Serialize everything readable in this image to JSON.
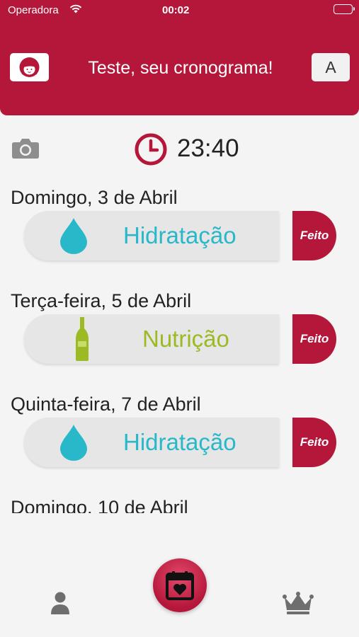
{
  "status_bar": {
    "carrier": "Operadora",
    "time": "00:02"
  },
  "header": {
    "title": "Teste, seu cronograma!",
    "font_button_label": "A"
  },
  "timer": {
    "time": "23:40"
  },
  "schedule": [
    {
      "date": "Domingo, 3 de Abril",
      "treatment": "Hidratação",
      "icon": "water-drop-icon",
      "color": "#29b8c9",
      "done_label": "Feito"
    },
    {
      "date": "Terça-feira, 5 de Abril",
      "treatment": "Nutrição",
      "icon": "oil-bottle-icon",
      "color": "#9cba24",
      "done_label": "Feito"
    },
    {
      "date": "Quinta-feira, 7 de Abril",
      "treatment": "Hidratação",
      "icon": "water-drop-icon",
      "color": "#29b8c9",
      "done_label": "Feito"
    },
    {
      "date": "Domingo, 10 de Abril"
    }
  ],
  "tab_bar": {
    "items": [
      "person-icon",
      "calendar-heart-icon",
      "crown-icon"
    ]
  },
  "colors": {
    "brand": "#b5173b",
    "hydration": "#29b8c9",
    "nutrition": "#9cba24"
  }
}
